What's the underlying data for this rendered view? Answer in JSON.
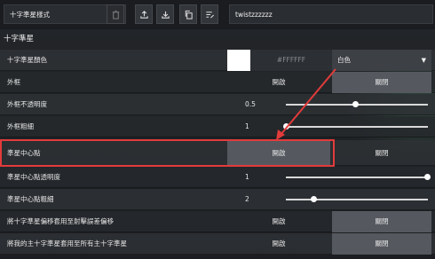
{
  "topbar": {
    "preset": "十字準星樣式",
    "code": "twistzzzzzz",
    "tools": [
      "trash-icon",
      "upload-icon",
      "download-icon",
      "copy-icon",
      "edit-list-icon"
    ]
  },
  "section": {
    "title": "十字準星"
  },
  "rows": {
    "color": {
      "label": "十字準星顏色",
      "hex": "#FFFFFF",
      "selected": "白色"
    },
    "outline": {
      "label": "外框",
      "on": "開啟",
      "off": "關閉",
      "active": "off"
    },
    "outline_opacity": {
      "label": "外框不透明度",
      "value": "0.5",
      "fraction": 0.49
    },
    "outline_thickness": {
      "label": "外框粗細",
      "value": "1",
      "fraction": 0.0
    },
    "center_dot": {
      "label": "準星中心點",
      "on": "開啟",
      "off": "關閉",
      "active": "on"
    },
    "center_dot_opacity": {
      "label": "準星中心點透明度",
      "value": "1",
      "fraction": 1.0
    },
    "center_dot_thickness": {
      "label": "準星中心點粗細",
      "value": "2",
      "fraction": 0.2
    },
    "firing_error": {
      "label": "將十字準星偏移套用至射擊誤差偏移",
      "on": "開啟",
      "off": "關閉",
      "active": "off"
    },
    "apply_all": {
      "label": "將我的主十字準星套用至所有主十字準星",
      "on": "開啟",
      "off": "關閉",
      "active": "off"
    }
  },
  "colors": {
    "highlight": "#e23b3b",
    "swatch": "#FFFFFF"
  }
}
